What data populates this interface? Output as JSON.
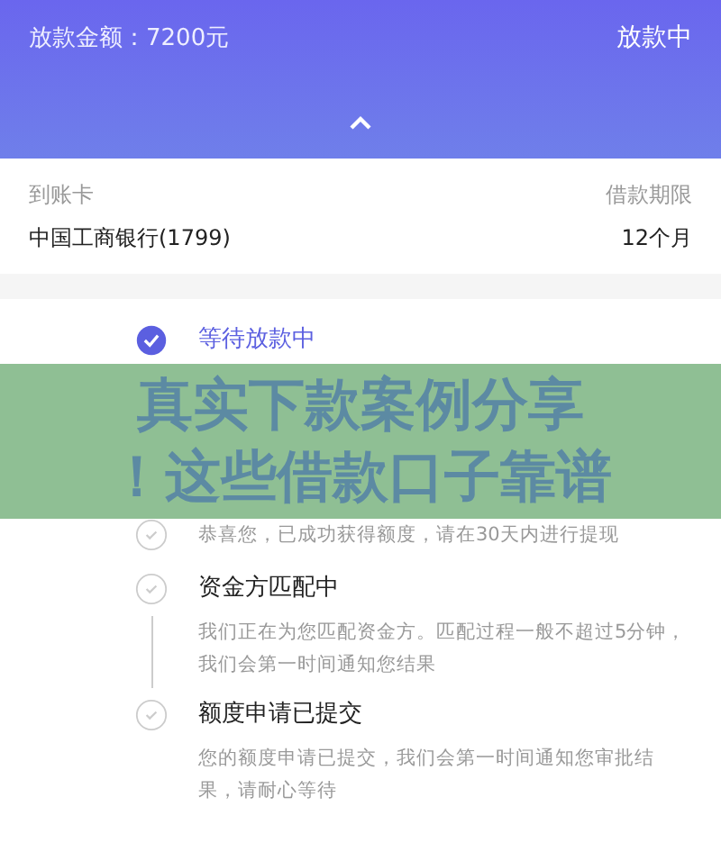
{
  "header": {
    "amount": "放款金额：7200元",
    "status": "放款中"
  },
  "info": {
    "card_label": "到账卡",
    "term_label": "借款期限",
    "card_value": "中国工商银行(1799)",
    "term_value": "12个月"
  },
  "steps": [
    {
      "title": "等待放款中",
      "active": true
    },
    {
      "description": "恭喜您，已成功获得额度，请在30天内进行提现",
      "active": false
    },
    {
      "title": "资金方匹配中",
      "description": "我们正在为您匹配资金方。匹配过程一般不超过5分钟，我们会第一时间通知您结果",
      "active": false
    },
    {
      "title": "额度申请已提交",
      "description": "您的额度申请已提交，我们会第一时间通知您审批结果，请耐心等待",
      "active": false
    }
  ],
  "banner": {
    "lines": [
      "真实下款案例分享",
      "！这些借款口子靠谱"
    ]
  }
}
